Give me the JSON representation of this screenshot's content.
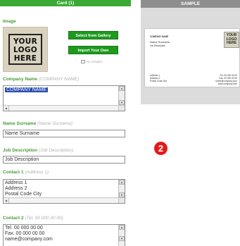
{
  "panel": {
    "title": "Card (1)"
  },
  "image": {
    "title": "Image",
    "logo_text": "YOUR\nLOGO\nHERE",
    "select_button": "Select from Gallery",
    "import_button": "Import Your Own",
    "no_graphic_label": "No Graphic"
  },
  "company": {
    "label": "Company Name",
    "hint": "(COMPANY NAME)",
    "value": "COMPANY NAME"
  },
  "name": {
    "label": "Name Surname",
    "hint": "(Name Surname)",
    "value": "Name Surname"
  },
  "job": {
    "label": "Job Description",
    "hint": "(Job Description)",
    "value": "Job Description"
  },
  "contact1": {
    "label": "Contact 1",
    "hint": "(Address 1)",
    "lines": [
      "Address 1",
      "Address 2",
      "Postal Code  City"
    ]
  },
  "contact2": {
    "label": "Contact 2",
    "hint": "(Tel. 00 000 00 00)",
    "lines": [
      "Tel. 00 000 00 00",
      "Fax. 00 000 00 00",
      "name@company.com"
    ]
  },
  "preview": {
    "title": "SAMPLE",
    "card": {
      "company": "COMPANY NAME",
      "name": "Name Surname",
      "job": "Job Description",
      "logo": "YOUR\nLOGO\nHERE",
      "addr": [
        "Address 1",
        "Address 2",
        "Postal Code City"
      ],
      "contact": [
        "Tel. 00 000 00 00",
        "Fax. 00 000 00 00",
        "name@company.com",
        "www.company.com"
      ]
    }
  },
  "step_badge": "2",
  "colors": {
    "accent_green": "#3aaa35",
    "button_green": "#1e9a1e",
    "badge_red": "#e31b1b"
  }
}
